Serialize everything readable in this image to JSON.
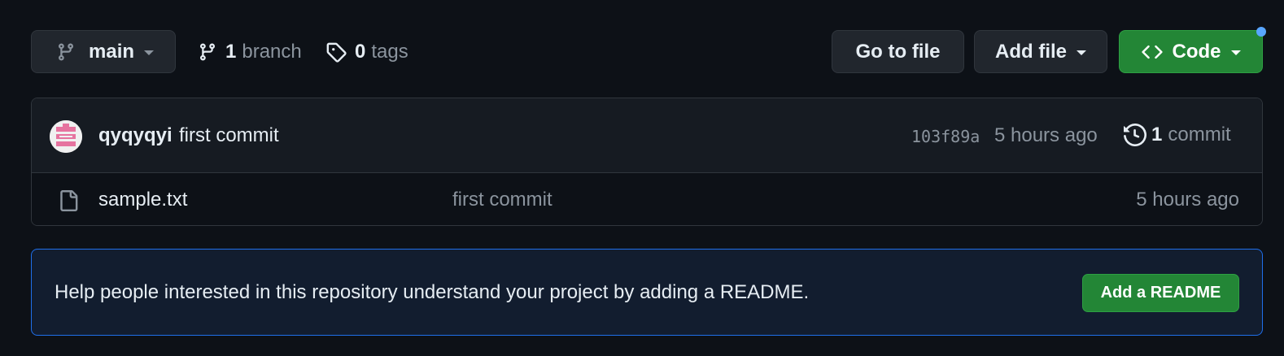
{
  "toolbar": {
    "branch_selector": {
      "label": "main",
      "icon": "git-branch-icon"
    },
    "branches": {
      "count": "1",
      "label": "branch",
      "icon": "git-branch-icon"
    },
    "tags": {
      "count": "0",
      "label": "tags",
      "icon": "tag-icon"
    },
    "go_to_file_label": "Go to file",
    "add_file_label": "Add file",
    "code_label": "Code",
    "code_icon": "code-icon"
  },
  "latest_commit": {
    "author": "qyqyqyi",
    "message": "first commit",
    "sha": "103f89a",
    "time": "5 hours ago",
    "commit_count": "1",
    "commit_count_label": "commit",
    "history_icon": "history-icon"
  },
  "files": [
    {
      "name": "sample.txt",
      "last_commit_message": "first commit",
      "last_commit_time": "5 hours ago",
      "icon": "file-icon"
    }
  ],
  "readme_banner": {
    "text": "Help people interested in this repository understand your project by adding a README.",
    "button_label": "Add a README"
  },
  "colors": {
    "background": "#0d1117",
    "surface": "#161b22",
    "border": "#30363d",
    "primary_green": "#238636",
    "accent_blue": "#58a6ff",
    "muted_text": "#8b949e",
    "avatar_pink": "#e6739f"
  }
}
